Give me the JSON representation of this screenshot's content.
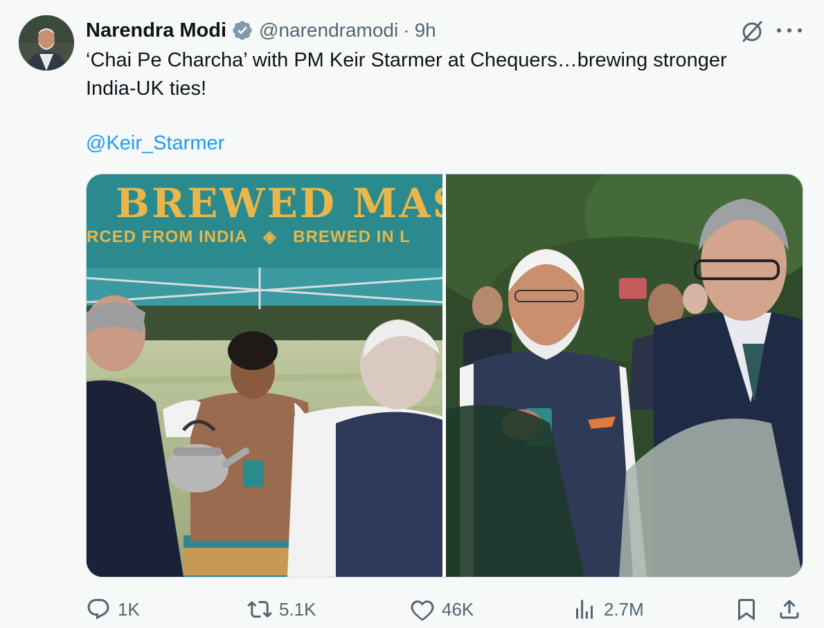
{
  "author": {
    "name": "Narendra Modi",
    "handle": "@narendramodi",
    "separator": "·",
    "time": "9h"
  },
  "tweet": {
    "text": "‘Chai Pe Charcha’ with PM Keir Starmer at Chequers…brewing stronger India-UK ties!",
    "mention": "@Keir_Starmer"
  },
  "media": {
    "left_banner_title": "BREWED MAS",
    "left_banner_sub_a": "RCED FROM INDIA",
    "left_banner_sub_b": "BREWED IN L"
  },
  "actions": {
    "replies": "1K",
    "reposts": "5.1K",
    "likes": "46K",
    "views": "2.7M"
  },
  "icons": {
    "verified": "verified-badge-icon",
    "grok": "grok-icon",
    "more": "more-icon",
    "reply": "reply-icon",
    "repost": "repost-icon",
    "like": "heart-icon",
    "views": "views-icon",
    "bookmark": "bookmark-icon",
    "share": "share-icon"
  },
  "colors": {
    "link": "#1d9bf0",
    "secondary_text": "#536471",
    "verified_badge": "#829aab",
    "banner_teal": "#2a8a8e",
    "banner_gold": "#e8b64a"
  }
}
